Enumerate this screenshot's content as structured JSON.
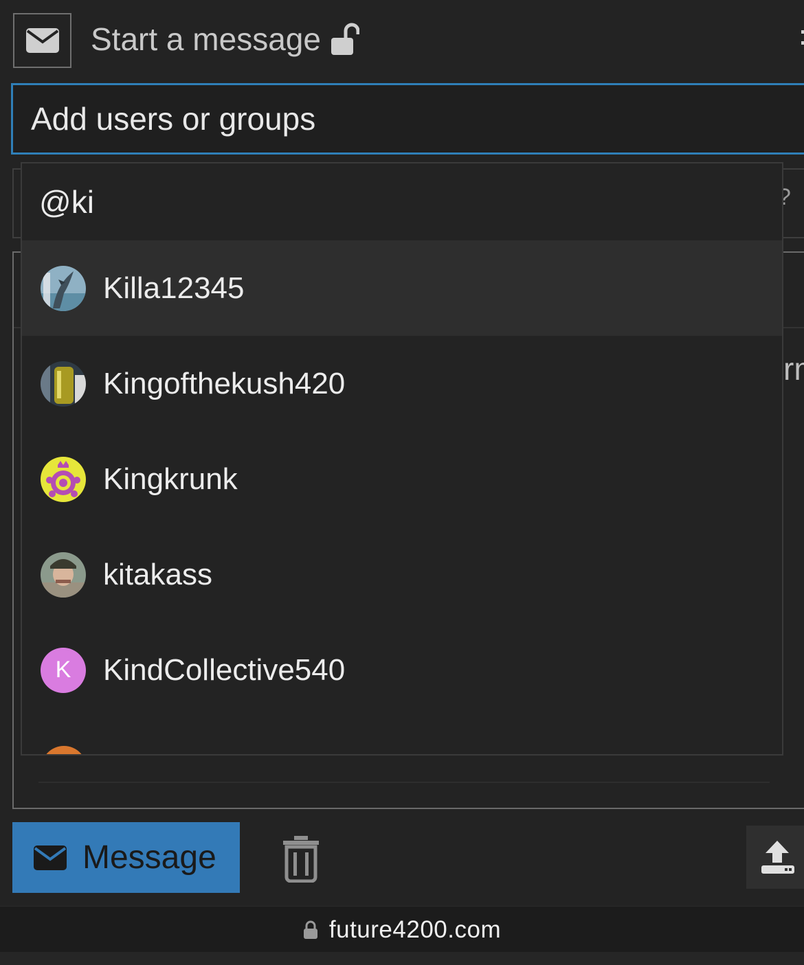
{
  "header": {
    "title": "Start a message",
    "mail_icon": "envelope-icon",
    "lock_icon": "unlock-icon"
  },
  "recipients": {
    "placeholder": "Add users or groups"
  },
  "dropdown": {
    "query": "@ki",
    "items": [
      {
        "name": "Killa12345",
        "avatar": "dolphin-photo",
        "active": true
      },
      {
        "name": "Kingofthekush420",
        "avatar": "jar-photo",
        "active": false
      },
      {
        "name": "Kingkrunk",
        "avatar": "turtle-emblem",
        "active": false
      },
      {
        "name": "kitakass",
        "avatar": "man-photo",
        "active": false
      },
      {
        "name": "KindCollective540",
        "avatar_letter": "K",
        "avatar_color": "#d97ce0",
        "active": false
      }
    ]
  },
  "actions": {
    "message_label": "Message",
    "message_color": "#337ab7"
  },
  "browser": {
    "url": "future4200.com"
  },
  "background_fragments": {
    "question_mark": "?",
    "text_fragment": "rm"
  },
  "colors": {
    "focus_border": "#2f7fb8",
    "background": "#232323"
  }
}
